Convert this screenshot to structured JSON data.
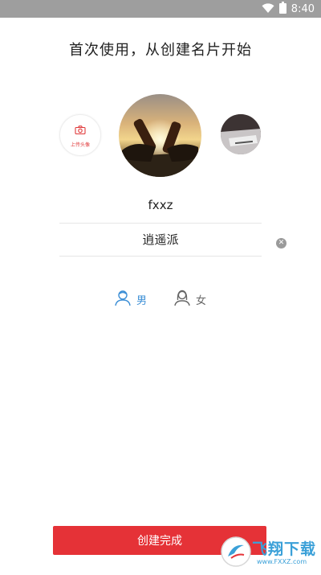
{
  "status_bar": {
    "time": "8:40",
    "icons": [
      "wifi-icon",
      "battery-icon"
    ]
  },
  "title": "首次使用，从创建名片开始",
  "avatars": {
    "upload_label": "上传头像",
    "main": "sunset-beer-photo",
    "side": "desk-photo"
  },
  "form": {
    "name_value": "fxxz",
    "signature_value": "逍遥派"
  },
  "gender": {
    "male_label": "男",
    "female_label": "女",
    "selected": "male"
  },
  "create_button_label": "创建完成",
  "watermark": {
    "brand": "飞翔下载",
    "url": "www.FXXZ.com"
  },
  "colors": {
    "accent_red": "#e53237",
    "male_blue": "#3d8fd6",
    "status_bar": "#9e9e9e"
  }
}
